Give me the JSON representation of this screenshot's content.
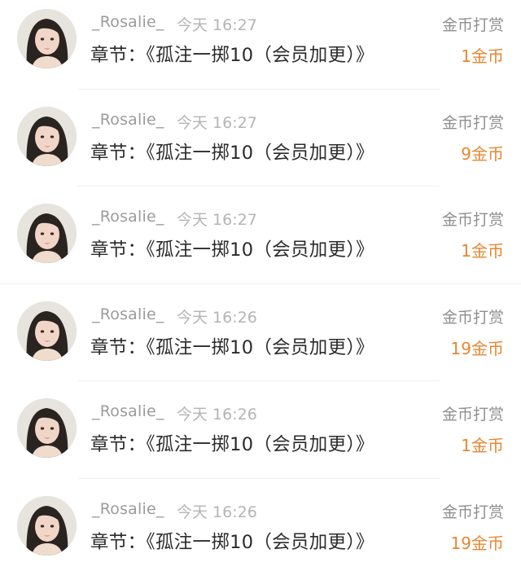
{
  "colors": {
    "username": "#9b9b9b",
    "time": "#b4b4b4",
    "chapter": "#2b2b2b",
    "type": "#8f8f8f",
    "amount": "#e8862f"
  },
  "rows": [
    {
      "username": "_Rosalie_",
      "time": "今天 16:27",
      "chapter": "章节：《孤注一掷10（会员加更）》",
      "type": "金币打赏",
      "amount": "1金币",
      "avatar": "user-avatar"
    },
    {
      "username": "_Rosalie_",
      "time": "今天 16:27",
      "chapter": "章节：《孤注一掷10（会员加更）》",
      "type": "金币打赏",
      "amount": "9金币",
      "avatar": "user-avatar"
    },
    {
      "username": "_Rosalie_",
      "time": "今天 16:27",
      "chapter": "章节：《孤注一掷10（会员加更）》",
      "type": "金币打赏",
      "amount": "1金币",
      "avatar": "user-avatar"
    },
    {
      "username": "_Rosalie_",
      "time": "今天 16:26",
      "chapter": "章节：《孤注一掷10（会员加更）》",
      "type": "金币打赏",
      "amount": "19金币",
      "avatar": "user-avatar"
    },
    {
      "username": "_Rosalie_",
      "time": "今天 16:26",
      "chapter": "章节：《孤注一掷10（会员加更）》",
      "type": "金币打赏",
      "amount": "1金币",
      "avatar": "user-avatar"
    },
    {
      "username": "_Rosalie_",
      "time": "今天 16:26",
      "chapter": "章节：《孤注一掷10（会员加更）》",
      "type": "金币打赏",
      "amount": "19金币",
      "avatar": "user-avatar"
    }
  ]
}
